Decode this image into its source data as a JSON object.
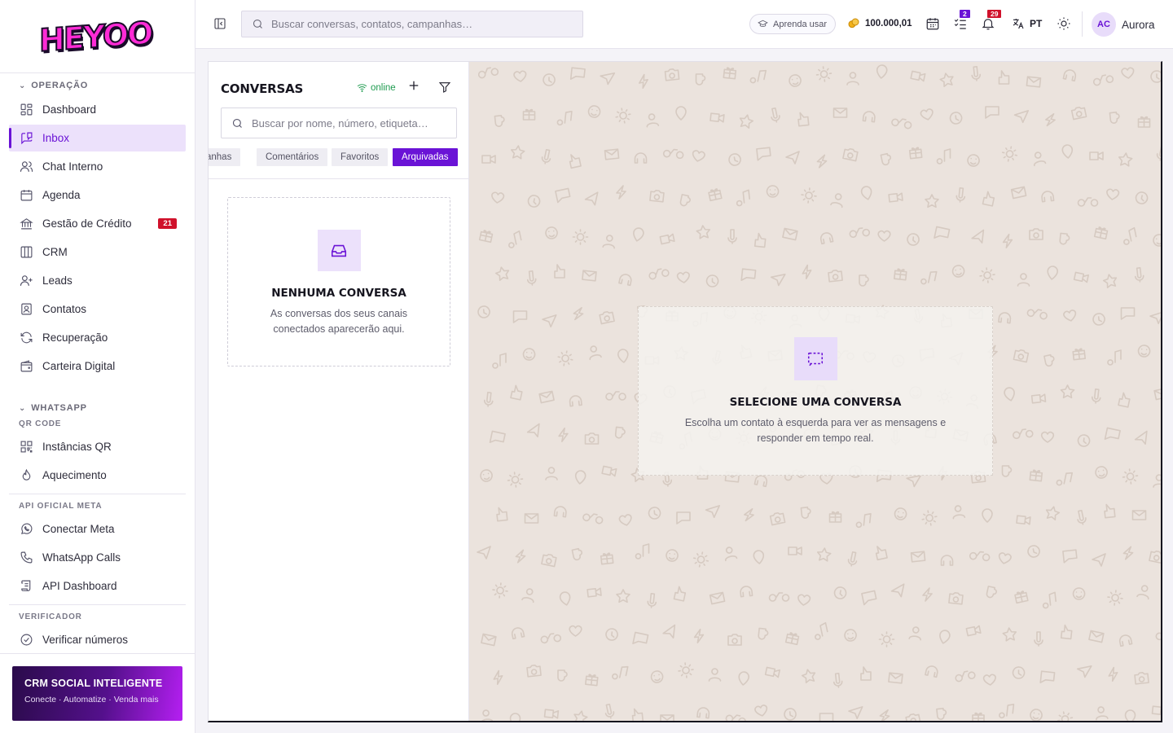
{
  "brand": {
    "logo_text": "HEYOO"
  },
  "topbar": {
    "search_placeholder": "Buscar conversas, contatos, campanhas…",
    "learn_label": "Aprenda usar",
    "credits": "100.000,01",
    "tasks_badge": "2",
    "notifications_badge": "29",
    "language": "PT",
    "user_initials": "AC",
    "user_name": "Aurora",
    "colors": {
      "tasks_badge": "#6a13d6",
      "notifications_badge": "#d0112b"
    }
  },
  "sidebar": {
    "sections": {
      "operacao": "OPERAÇÃO",
      "whatsapp": "WHATSAPP",
      "qr_code": "QR CODE",
      "api_oficial": "API OFICIAL META",
      "verificador": "VERIFICADOR"
    },
    "items": [
      {
        "label": "Dashboard",
        "icon": "dashboard-icon"
      },
      {
        "label": "Inbox",
        "icon": "inbox-icon",
        "active": true
      },
      {
        "label": "Chat Interno",
        "icon": "users-icon"
      },
      {
        "label": "Agenda",
        "icon": "calendar-icon"
      },
      {
        "label": "Gestão de Crédito",
        "icon": "bank-icon",
        "badge": "21"
      },
      {
        "label": "CRM",
        "icon": "columns-icon"
      },
      {
        "label": "Leads",
        "icon": "user-plus-icon"
      },
      {
        "label": "Contatos",
        "icon": "contact-card-icon"
      },
      {
        "label": "Recuperação",
        "icon": "refresh-icon"
      },
      {
        "label": "Carteira Digital",
        "icon": "wallet-icon"
      },
      {
        "label": "Instâncias QR",
        "icon": "qr-icon"
      },
      {
        "label": "Aquecimento",
        "icon": "flame-icon"
      },
      {
        "label": "Conectar Meta",
        "icon": "whatsapp-icon"
      },
      {
        "label": "WhatsApp Calls",
        "icon": "phone-icon"
      },
      {
        "label": "API Dashboard",
        "icon": "scroll-icon"
      },
      {
        "label": "Verificar números",
        "icon": "check-circle-icon"
      }
    ],
    "promo": {
      "title": "CRM SOCIAL INTELIGENTE",
      "subtitle": "Conecte · Automatize · Venda mais"
    }
  },
  "conversations": {
    "title": "CONVERSAS",
    "status": "online",
    "search_placeholder": "Buscar por nome, número, etiqueta…",
    "tabs": [
      "anhas",
      "Comentários",
      "Favoritos",
      "Arquivadas"
    ],
    "active_tab": "Arquivadas",
    "empty_title": "NENHUMA CONVERSA",
    "empty_text": "As conversas dos seus canais conectados aparecerão aqui."
  },
  "chat": {
    "empty_title": "SELECIONE UMA CONVERSA",
    "empty_text": "Escolha um contato à esquerda para ver as mensagens e responder em tempo real."
  }
}
